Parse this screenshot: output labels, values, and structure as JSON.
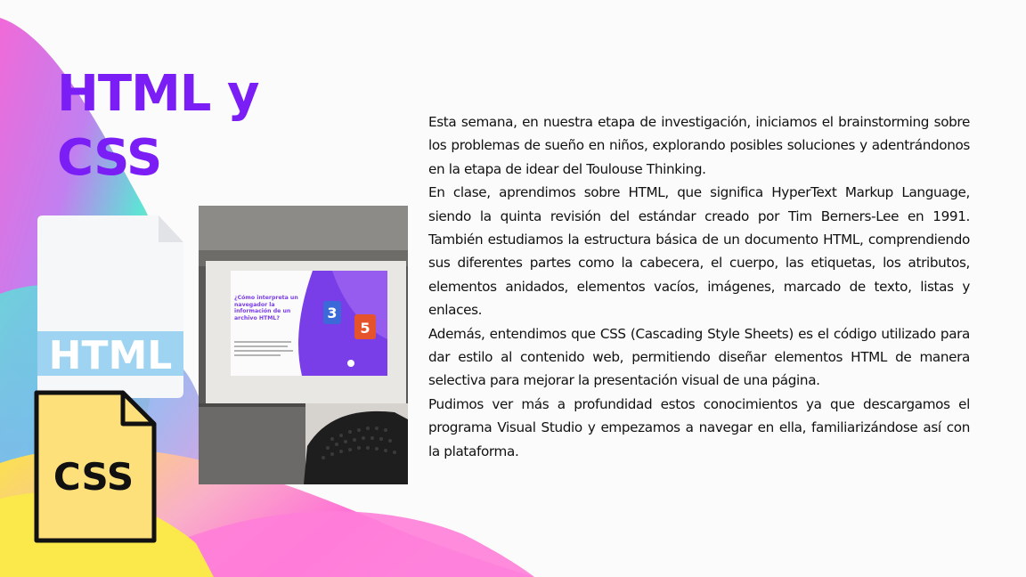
{
  "title": {
    "line1": "HTML y",
    "line2": "CSS"
  },
  "icons": {
    "html_file": {
      "label": "HTML",
      "name": "html-file-icon"
    },
    "css_file": {
      "label": "CSS",
      "name": "css-file-icon"
    }
  },
  "photo": {
    "slide_heading": "¿Cómo interpreta un navegador la información de un archivo HTML?",
    "badge_css": "3",
    "badge_html": "5"
  },
  "paragraphs": [
    "Esta semana, en nuestra etapa de investigación, iniciamos el brainstorming sobre los problemas de sueño en niños, explorando posibles soluciones y adentrándonos en la etapa de idear del Toulouse Thinking.",
    "En clase, aprendimos sobre HTML, que significa HyperText Markup Language, siendo la quinta revisión del estándar creado por Tim Berners-Lee en 1991. También estudiamos la estructura básica de un documento HTML, comprendiendo sus diferentes partes como la cabecera, el cuerpo, las etiquetas, los atributos, elementos anidados, elementos vacíos, imágenes, marcado de texto, listas y enlaces.",
    "Además, entendimos que CSS (Cascading Style Sheets) es el código utilizado para dar estilo al contenido web, permitiendo diseñar elementos HTML de manera selectiva para mejorar la presentación visual de una página.",
    "Pudimos ver más a profundidad estos conocimientos ya que descargamos el programa Visual Studio y empezamos a navegar en ella, familiarizándose así con la plataforma."
  ],
  "colors": {
    "title": "#7b1ef5",
    "background": "#fbfbfb",
    "css_file": "#fde07a",
    "html_band": "#9ed4f2"
  }
}
